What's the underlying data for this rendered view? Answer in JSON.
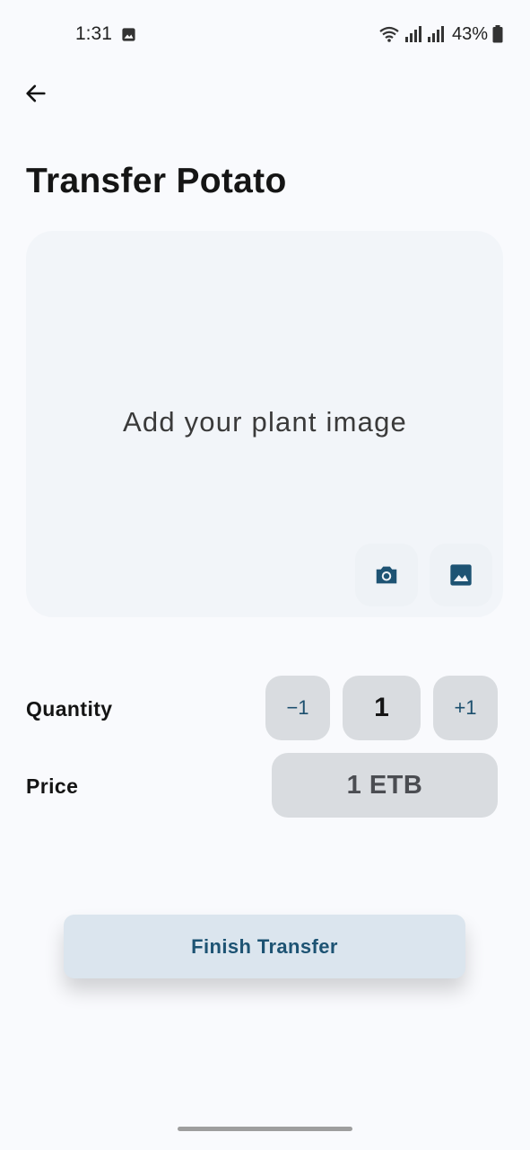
{
  "status_bar": {
    "time": "1:31",
    "battery": "43%",
    "icons": [
      "image-icon",
      "wifi-icon",
      "signal-icon",
      "signal-icon",
      "battery-icon"
    ]
  },
  "header": {
    "back_icon": "arrow-left-icon",
    "title": "Transfer Potato"
  },
  "image_picker": {
    "placeholder": "Add your plant image",
    "camera_icon": "camera-icon",
    "gallery_icon": "image-icon"
  },
  "quantity": {
    "label": "Quantity",
    "decrement_label": "−1",
    "value": "1",
    "increment_label": "+1"
  },
  "price": {
    "label": "Price",
    "value": "1 ETB"
  },
  "actions": {
    "finish_label": "Finish Transfer"
  },
  "colors": {
    "background": "#f9fafd",
    "accent": "#1d5373",
    "button_bg": "#dbe5ee",
    "pill_bg": "#d9dce0"
  }
}
